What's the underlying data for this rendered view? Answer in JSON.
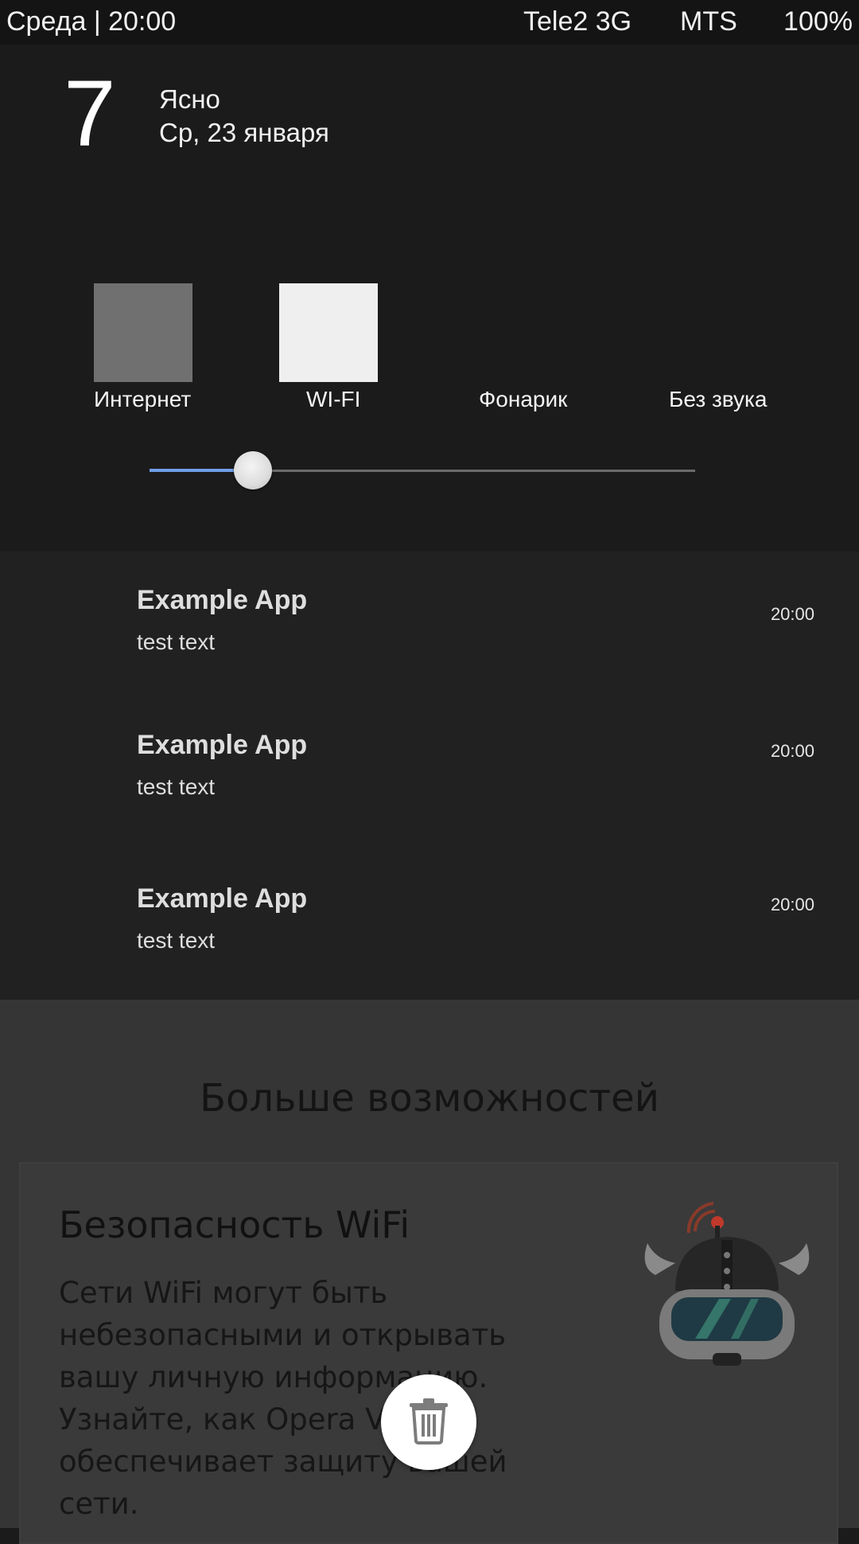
{
  "status_bar": {
    "left": "Среда | 20:00",
    "carrier1": "Tele2 3G",
    "carrier2": "MTS",
    "battery": "100%"
  },
  "weather": {
    "temperature": "7",
    "condition": "Ясно",
    "date": "Ср, 23 января"
  },
  "toggles": [
    {
      "label": "Интернет",
      "color": "#707070"
    },
    {
      "label": "WI-FI",
      "color": "#efefef"
    },
    {
      "label": "Фонарик"
    },
    {
      "label": "Без звука"
    }
  ],
  "brightness": {
    "value": 0.19,
    "accent": "#6f9fe8"
  },
  "notifications": [
    {
      "app": "Example App",
      "text": "test text",
      "time": "20:00"
    },
    {
      "app": "Example App",
      "text": "test text",
      "time": "20:00"
    },
    {
      "app": "Example App",
      "text": "test text",
      "time": "20:00"
    }
  ],
  "promo": {
    "heading": "Больше возможностей",
    "card_title": "Безопасность WiFi",
    "card_body": "Сети WiFi могут быть небезопасными и открывать вашу личную информацию. Узнайте, как Opera VPN обеспечивает защиту вашей сети."
  },
  "icons": {
    "trash": "trash-icon",
    "mascot": "vpn-viking-mascot"
  }
}
